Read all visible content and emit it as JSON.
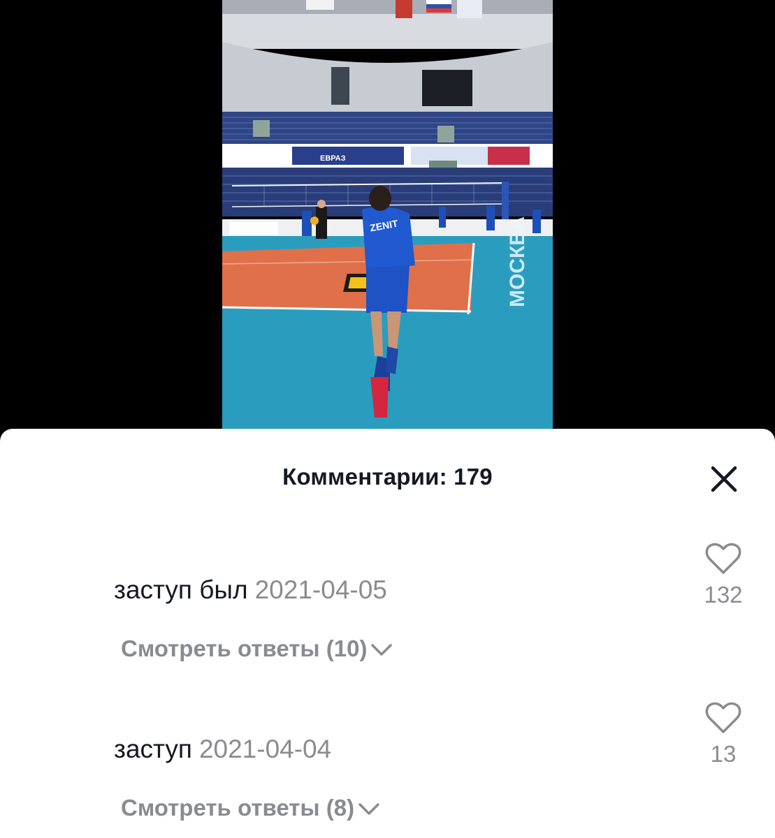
{
  "comments_panel": {
    "title": "Комментарии: 179",
    "close_icon": "close-icon",
    "comments": [
      {
        "text": "заступ был",
        "date": "2021-04-05",
        "view_replies": "Смотреть ответы (10)",
        "likes": "132"
      },
      {
        "text": "заступ",
        "date": "2021-04-04",
        "view_replies": "Смотреть ответы (8)",
        "likes": "13"
      }
    ]
  },
  "video": {
    "jersey_text": "ZENIT",
    "sponsor_text": "ЕВРАЗ"
  },
  "colors": {
    "court_blue": "#2a9dbf",
    "court_orange": "#e0704a",
    "seats_blue": "#2b3f78",
    "muted_text": "#8a8b91",
    "primary_text": "#161823"
  }
}
